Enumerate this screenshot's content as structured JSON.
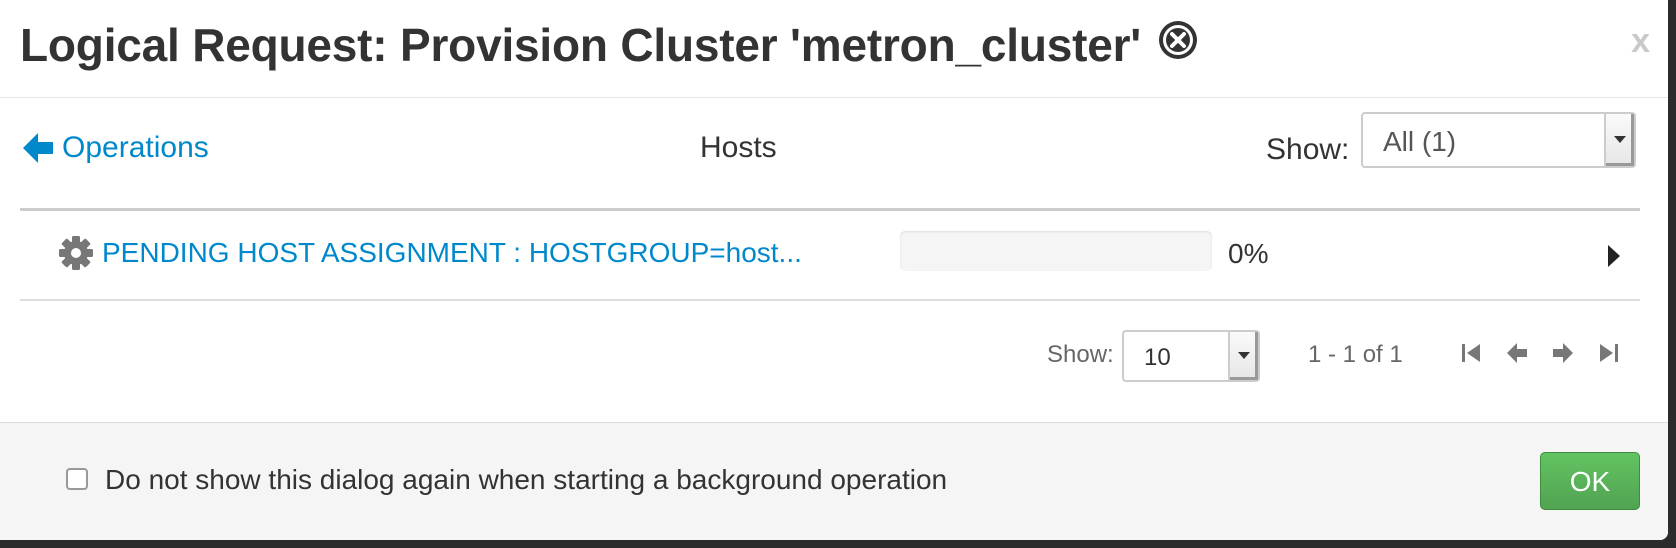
{
  "header": {
    "title": "Logical Request: Provision Cluster 'metron_cluster'",
    "close_label": "x"
  },
  "nav": {
    "back_label": "Operations",
    "section_title": "Hosts",
    "show_label": "Show:",
    "filter_value": "All (1)"
  },
  "hosts": [
    {
      "name": "PENDING HOST ASSIGNMENT : HOSTGROUP=host...",
      "progress_percent": 0,
      "progress_label": "0%"
    }
  ],
  "pagination": {
    "show_label": "Show:",
    "page_size": "10",
    "range_text": "1 - 1 of 1"
  },
  "footer": {
    "checkbox_label": "Do not show this dialog again when starting a background operation",
    "ok_label": "OK"
  },
  "colors": {
    "link": "#0088cc",
    "ok_button": "#5bb75b"
  }
}
